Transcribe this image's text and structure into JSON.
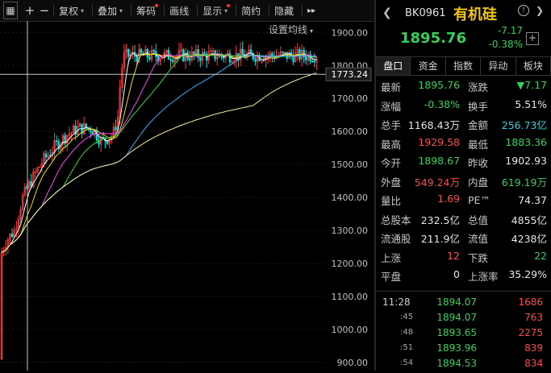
{
  "toolbar": {
    "buttons": [
      {
        "label": "复权",
        "caret": true,
        "dot": false
      },
      {
        "label": "叠加",
        "caret": true,
        "dot": false
      },
      {
        "label": "筹码",
        "caret": false,
        "dot": true
      },
      {
        "label": "画线",
        "caret": false,
        "dot": false
      },
      {
        "label": "显示",
        "caret": true,
        "dot": true
      },
      {
        "label": "简约",
        "caret": false,
        "dot": false
      },
      {
        "label": "隐藏",
        "caret": false,
        "dot": false
      }
    ],
    "more": "▸▸"
  },
  "chart": {
    "settings_label": "设置均线",
    "y_axis": [
      "1900.00",
      "1800.00",
      "1700.00",
      "1600.00",
      "1500.00",
      "1400.00",
      "1300.00",
      "1200.00",
      "1100.00",
      "1000.00",
      "900.00"
    ],
    "crosshair_value": "1773.24"
  },
  "chart_data": {
    "type": "line",
    "title": "",
    "ylim": [
      875,
      1935
    ],
    "ticks": [
      1900,
      1800,
      1700,
      1600,
      1500,
      1400,
      1300,
      1200,
      1100,
      1000,
      900
    ],
    "crosshair": 1773.24,
    "colors": {
      "up": "#ff3a3a",
      "down": "#00e0e0",
      "ma5": "#ffffff",
      "ma10": "#f0e000",
      "ma20": "#ff40ff",
      "ma30": "#30e030",
      "ma60": "#30b0ff",
      "ma120": "#f0f0a0"
    }
  },
  "header": {
    "code": "BK0961",
    "name": "有机硅",
    "price": "1895.76",
    "change": "-7.17",
    "change_pct": "-0.38%"
  },
  "tabs": [
    "盘口",
    "资金",
    "指数",
    "异动",
    "板块"
  ],
  "stats": [
    [
      {
        "label": "最新",
        "value": "1895.76",
        "color": "g"
      },
      {
        "label": "涨跌",
        "value": "▼7.17",
        "color": "g"
      }
    ],
    [
      {
        "label": "涨幅",
        "value": "-0.38%",
        "color": "g"
      },
      {
        "label": "换手",
        "value": "5.51%",
        "color": "w"
      }
    ],
    [
      {
        "label": "总手",
        "value": "1168.43万",
        "color": "w"
      },
      {
        "label": "金额",
        "value": "256.73亿",
        "color": "c"
      }
    ],
    [
      {
        "label": "最高",
        "value": "1929.58",
        "color": "r"
      },
      {
        "label": "最低",
        "value": "1883.36",
        "color": "g"
      }
    ],
    [
      {
        "label": "今开",
        "value": "1898.67",
        "color": "g"
      },
      {
        "label": "昨收",
        "value": "1902.93",
        "color": "w"
      }
    ],
    [
      {
        "label": "外盘",
        "value": "549.24万",
        "color": "r"
      },
      {
        "label": "内盘",
        "value": "619.19万",
        "color": "g"
      }
    ],
    [
      {
        "label": "量比",
        "value": "1.69",
        "color": "r"
      },
      {
        "label": "PE™",
        "value": "74.37",
        "color": "w"
      }
    ],
    [
      {
        "label": "总股本",
        "value": "232.5亿",
        "color": "w"
      },
      {
        "label": "总值",
        "value": "4855亿",
        "color": "w"
      }
    ],
    [
      {
        "label": "流通股",
        "value": "211.9亿",
        "color": "w"
      },
      {
        "label": "流值",
        "value": "4238亿",
        "color": "w"
      }
    ],
    [
      {
        "label": "上涨",
        "value": "12",
        "color": "r"
      },
      {
        "label": "下跌",
        "value": "22",
        "color": "g"
      }
    ],
    [
      {
        "label": "平盘",
        "value": "0",
        "color": "w"
      },
      {
        "label": "上涨率",
        "value": "35.29%",
        "color": "w"
      }
    ]
  ],
  "trades": [
    {
      "time": "11:28",
      "price": "1894.07",
      "vol": "1686"
    },
    {
      "time": ":45",
      "price": "1894.07",
      "vol": "763"
    },
    {
      "time": ":48",
      "price": "1893.65",
      "vol": "2275"
    },
    {
      "time": ":51",
      "price": "1893.96",
      "vol": "839"
    },
    {
      "time": ":54",
      "price": "1894.53",
      "vol": "834"
    }
  ]
}
